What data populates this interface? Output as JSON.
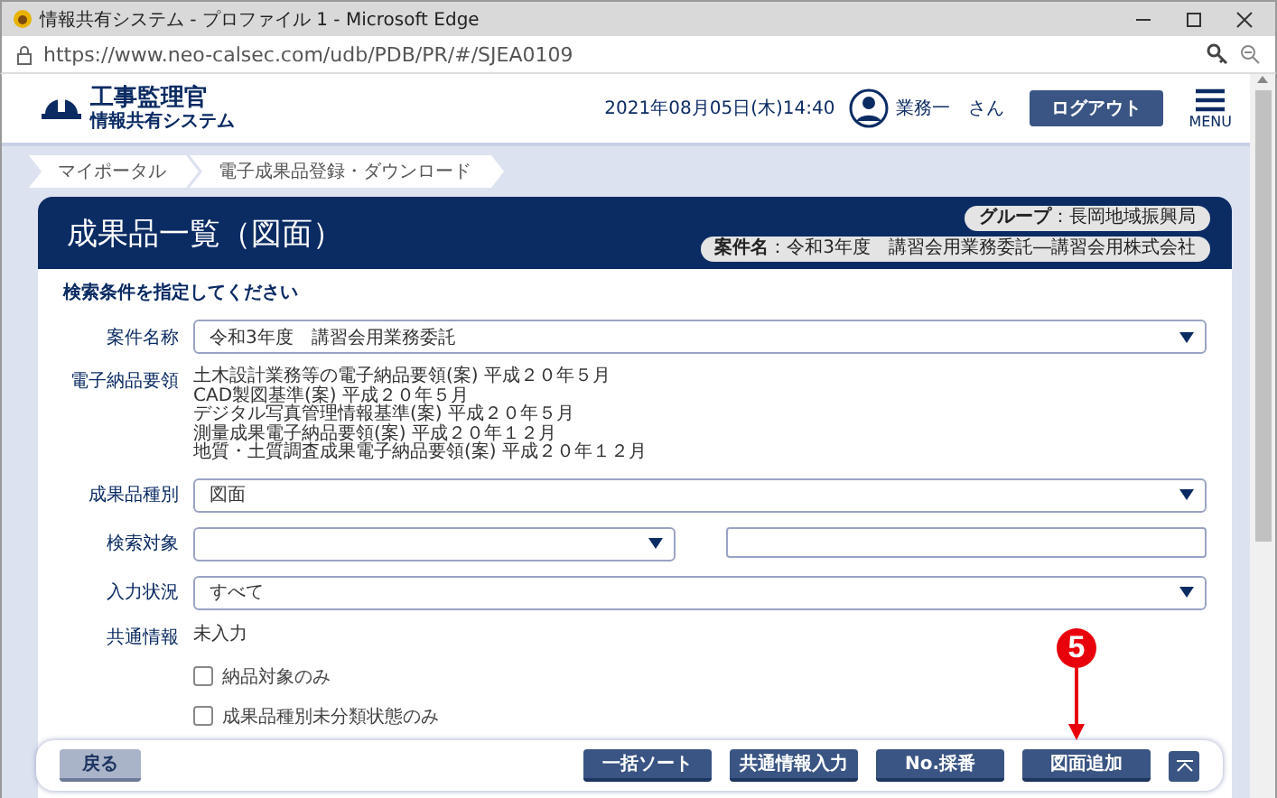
{
  "window": {
    "title": "情報共有システム - プロファイル 1 - Microsoft Edge"
  },
  "address_bar": {
    "url": "https://www.neo-calsec.com/udb/PDB/PR/#/SJEA0109"
  },
  "header": {
    "logo_title": "工事監理官",
    "logo_subtitle": "情報共有システム",
    "datetime": "2021年08月05日(木)14:40",
    "user": "業務一　さん",
    "logout": "ログアウト",
    "menu": "MENU"
  },
  "breadcrumb": [
    {
      "label": "マイポータル"
    },
    {
      "label": "電子成果品登録・ダウンロード"
    }
  ],
  "page": {
    "title": "成果品一覧（図面）",
    "group_label": "グループ",
    "group_value": "：長岡地域振興局",
    "case_label": "案件名",
    "case_value": "：令和3年度　講習会用業務委託―講習会用株式会社"
  },
  "search": {
    "heading": "検索条件を指定してください",
    "rows": [
      {
        "kind": "select",
        "label": "案件名称",
        "value": "令和3年度　講習会用業務委託"
      },
      {
        "kind": "list",
        "label": "電子納品要領",
        "lines": [
          "土木設計業務等の電子納品要領(案) 平成２０年５月",
          "CAD製図基準(案) 平成２０年５月",
          "デジタル写真管理情報基準(案) 平成２０年５月",
          "測量成果電子納品要領(案) 平成２０年１２月",
          "地質・土質調査成果電子納品要領(案) 平成２０年１２月"
        ]
      },
      {
        "kind": "select",
        "label": "成果品種別",
        "value": "図面"
      },
      {
        "kind": "select_text",
        "label": "検索対象"
      },
      {
        "kind": "select",
        "label": "入力状況",
        "value": "すべて"
      },
      {
        "kind": "text",
        "label": "共通情報",
        "value": "未入力"
      },
      {
        "kind": "checkbox",
        "label": "納品対象のみ",
        "checked": false
      },
      {
        "kind": "checkbox",
        "label": "成果品種別未分類状態のみ",
        "checked": false
      }
    ]
  },
  "footer": {
    "back": "戻る",
    "buttons": [
      "一括ソート",
      "共通情報入力",
      "No.採番",
      "図面追加"
    ]
  },
  "callout": {
    "number": "5"
  }
}
